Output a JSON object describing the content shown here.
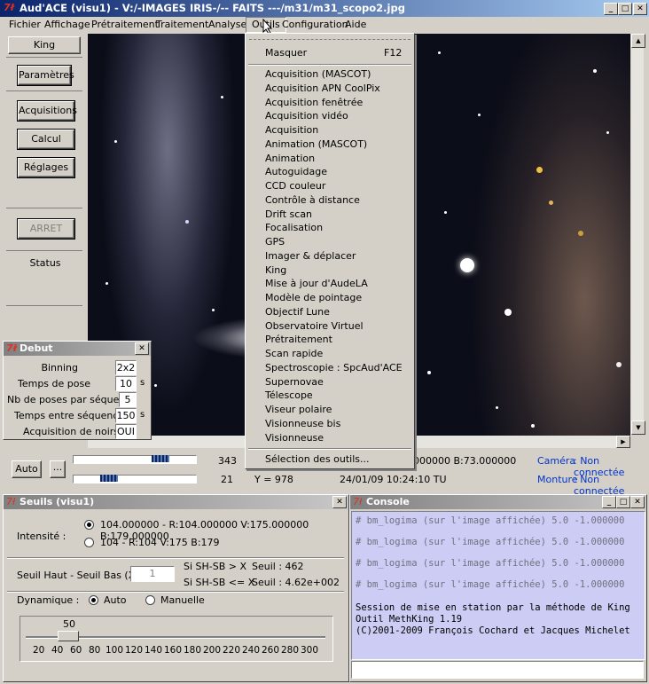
{
  "window": {
    "title": "Aud'ACE (visu1) - V:/-IMAGES IRIS-/-- FAITS ---/m31/m31_scopo2.jpg"
  },
  "menubar": [
    "Fichier",
    "Affichage",
    "Prétraitement",
    "Traitement",
    "Analyse",
    "Outils",
    "Configuration",
    "Aide"
  ],
  "left_panel": {
    "king": "King",
    "parametres": "Paramètres",
    "acquisitions": "Acquisitions",
    "calcul": "Calcul",
    "reglages": "Réglages",
    "arret": "ARRET",
    "status": "Status"
  },
  "debut": {
    "title": "Debut",
    "rows": [
      {
        "label": "Binning",
        "value": "2x2",
        "unit": ""
      },
      {
        "label": "Temps de pose",
        "value": "10",
        "unit": "s"
      },
      {
        "label": "Nb de poses par séquence",
        "value": "5",
        "unit": ""
      },
      {
        "label": "Temps entre séquences",
        "value": "150",
        "unit": "s"
      },
      {
        "label": "Acquisition de noirs",
        "value": "OUI",
        "unit": ""
      }
    ]
  },
  "outils_menu": {
    "masquer": "Masquer",
    "masquer_key": "F12",
    "items": [
      "Acquisition (MASCOT)",
      "Acquisition APN CoolPix",
      "Acquisition fenêtrée",
      "Acquisition vidéo",
      "Acquisition",
      "Animation (MASCOT)",
      "Animation",
      "Autoguidage",
      "CCD couleur",
      "Contrôle à distance",
      "Drift scan",
      "Focalisation",
      "GPS",
      "Imager & déplacer",
      "King",
      "Mise à jour d'AudeLA",
      "Modèle de pointage",
      "Objectif Lune",
      "Observatoire Virtuel",
      "Prétraitement",
      "Scan rapide",
      "Spectroscopie : SpcAud'ACE",
      "Supernovae",
      "Télescope",
      "Viseur polaire",
      "Visionneuse bis",
      "Visionneuse"
    ],
    "selection": "Sélection des outils..."
  },
  "statusbar": {
    "auto": "Auto",
    "ellipsis": "...",
    "val1": "343",
    "val2": "21",
    "y": "Y = 978",
    "rgb": "000000 B:73.000000",
    "datetime": "24/01/09 10:24:10 TU",
    "camera_label": "Caméra",
    "camera_value": ": Non connectée",
    "monture_label": "Monture",
    "monture_value": ": Non connectée"
  },
  "seuils": {
    "title": "Seuils (visu1)",
    "intensite": "Intensité :",
    "opt1": "104.000000 - R:104.000000 V:175.000000 B:179.000000",
    "opt2": "104 - R:104 V:175 B:179",
    "seuil_label": "Seuil Haut - Seuil Bas (X) :",
    "seuil_value": "1",
    "cond1": "Si SH-SB > X",
    "cond2": "Si SH-SB <= X",
    "res1": "Seuil : 462",
    "res2": "Seuil : 4.62e+002",
    "dynamique": "Dynamique :",
    "auto": "Auto",
    "manuelle": "Manuelle",
    "slider_value": "50",
    "ticks": [
      "20",
      "40",
      "60",
      "80",
      "100",
      "120",
      "140",
      "160",
      "180",
      "200",
      "220",
      "240",
      "260",
      "280",
      "300"
    ]
  },
  "console": {
    "title": "Console",
    "lines": [
      "# bm_logima (sur l'image affichée) 5.0 -1.000000",
      "# bm_logima (sur l'image affichée) 5.0 -1.000000",
      "# bm_logima (sur l'image affichée) 5.0 -1.000000",
      "# bm_logima (sur l'image affichée) 5.0 -1.000000"
    ],
    "output": [
      "Session de mise en station par la méthode de King",
      "Outil MethKing 1.19",
      "(C)2001-2009 François Cochard et Jacques Michelet"
    ]
  }
}
